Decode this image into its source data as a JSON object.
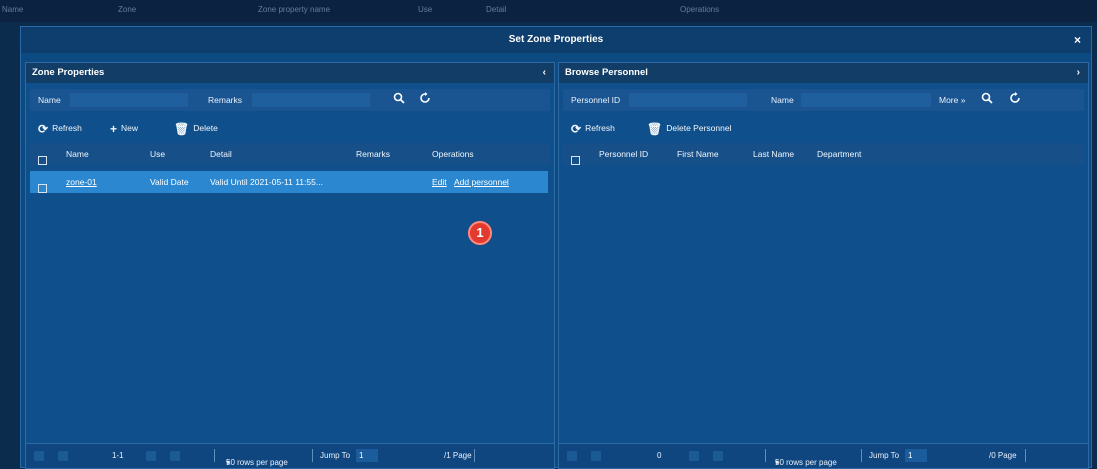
{
  "background_header": {
    "cols": [
      "Name",
      "Zone",
      "Zone property name",
      "Use",
      "Detail",
      "Operations"
    ]
  },
  "dialog": {
    "title": "Set Zone Properties",
    "close_glyph": "×"
  },
  "left_panel": {
    "title": "Zone Properties",
    "collapse_glyph": "‹",
    "search": {
      "name_label": "Name",
      "name_value": "",
      "remarks_label": "Remarks",
      "remarks_value": "",
      "search_icon": "search-icon",
      "reset_icon": "reset-icon"
    },
    "toolbar": {
      "refresh": "Refresh",
      "new": "New",
      "delete": "Delete"
    },
    "table": {
      "headers": [
        "Name",
        "Use",
        "Detail",
        "Remarks",
        "Operations"
      ],
      "rows": [
        {
          "name": "zone-01",
          "use": "Valid Date",
          "detail": "Valid Until 2021-05-11 11:55...",
          "remarks": "",
          "op_edit": "Edit",
          "op_add": "Add personnel"
        }
      ]
    },
    "badge": "1",
    "footer": {
      "range": "1-1",
      "rows_per_page": "50 rows per page",
      "dropdown_glyph": "▾",
      "jump_label": "Jump To",
      "jump_value": "1",
      "pages": "/1 Page"
    }
  },
  "right_panel": {
    "title": "Browse Personnel",
    "collapse_glyph": "›",
    "search": {
      "id_label": "Personnel ID",
      "id_value": "",
      "name_label": "Name",
      "name_value": "",
      "more_label": "More",
      "more_glyph": "»",
      "search_icon": "search-icon",
      "reset_icon": "reset-icon"
    },
    "toolbar": {
      "refresh": "Refresh",
      "delete_personnel": "Delete Personnel"
    },
    "table": {
      "headers": [
        "Personnel ID",
        "First Name",
        "Last Name",
        "Department"
      ]
    },
    "footer": {
      "range": "0",
      "rows_per_page": "50 rows per page",
      "dropdown_glyph": "▾",
      "jump_label": "Jump To",
      "jump_value": "1",
      "pages": "/0 Page"
    }
  },
  "colors": {
    "dialog_bg": "#0d4a82",
    "selected_row": "#2a87d0",
    "badge": "#e23a2e"
  }
}
